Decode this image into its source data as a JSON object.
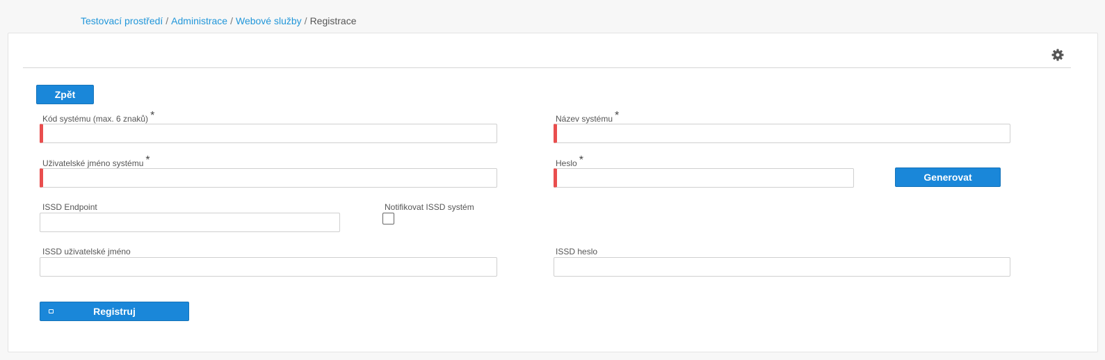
{
  "breadcrumb": {
    "items": [
      "Testovací prostředí",
      "Administrace",
      "Webové služby"
    ],
    "separator": "/",
    "current": "Registrace"
  },
  "toolbar": {
    "settings_icon": "gear-icon"
  },
  "buttons": {
    "back": "Zpět",
    "generate": "Generovat",
    "register": "Registruj"
  },
  "form": {
    "system_code": {
      "label": "Kód systému (max. 6 znaků)",
      "required_mark": "*",
      "value": ""
    },
    "system_name": {
      "label": "Název systému",
      "required_mark": "*",
      "value": ""
    },
    "system_username": {
      "label": "Uživatelské jméno systému",
      "required_mark": "*",
      "value": ""
    },
    "password": {
      "label": "Heslo",
      "required_mark": "*",
      "value": ""
    },
    "issd_endpoint": {
      "label": "ISSD Endpoint",
      "value": ""
    },
    "notify_issd": {
      "label": "Notifikovat ISSD systém",
      "checked": false
    },
    "issd_username": {
      "label": "ISSD uživatelské jméno",
      "value": ""
    },
    "issd_password": {
      "label": "ISSD heslo",
      "value": ""
    }
  },
  "colors": {
    "accent": "#1a87d9",
    "link": "#2196d9",
    "required": "#e94e4e"
  }
}
